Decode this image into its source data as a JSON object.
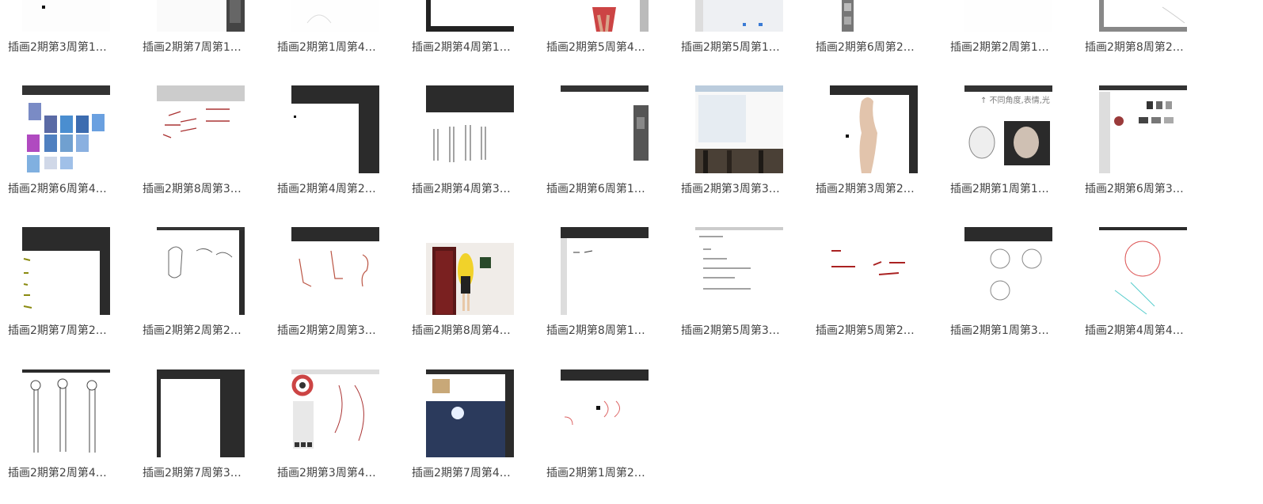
{
  "files": [
    {
      "name": "插画2期第3周第1…",
      "thumb": "blank-dot"
    },
    {
      "name": "插画2期第7周第1…",
      "thumb": "dark-right"
    },
    {
      "name": "插画2期第1周第4…",
      "thumb": "faint-sketch"
    },
    {
      "name": "插画2期第4周第1…",
      "thumb": "dark-frame"
    },
    {
      "name": "插画2期第5周第4…",
      "thumb": "red-figure"
    },
    {
      "name": "插画2期第5周第1…",
      "thumb": "white-panel"
    },
    {
      "name": "插画2期第6周第2…",
      "thumb": "gray-stack"
    },
    {
      "name": "插画2期第2周第1…",
      "thumb": "blank"
    },
    {
      "name": "插画2期第8周第2…",
      "thumb": "gray-frame"
    },
    {
      "name": "插画2期第6周第4…",
      "thumb": "color-grid"
    },
    {
      "name": "插画2期第8周第3…",
      "thumb": "red-notes"
    },
    {
      "name": "插画2期第4周第2…",
      "thumb": "dark-frame-big"
    },
    {
      "name": "插画2期第4周第3…",
      "thumb": "figures-lineup"
    },
    {
      "name": "插画2期第6周第1…",
      "thumb": "panel-right"
    },
    {
      "name": "插画2期第3周第3…",
      "thumb": "file-list-photo"
    },
    {
      "name": "插画2期第3周第2…",
      "thumb": "beige-silhouette"
    },
    {
      "name": "插画2期第1周第1…",
      "thumb": "skull-portrait"
    },
    {
      "name": "插画2期第6周第3…",
      "thumb": "shade-studies"
    },
    {
      "name": "插画2期第7周第2…",
      "thumb": "dark-green-text"
    },
    {
      "name": "插画2期第2周第2…",
      "thumb": "torso-sketch"
    },
    {
      "name": "插画2期第2周第3…",
      "thumb": "red-limbs"
    },
    {
      "name": "插画2期第8周第4…",
      "thumb": "girl-door"
    },
    {
      "name": "插画2期第8周第1…",
      "thumb": "dark-top-note"
    },
    {
      "name": "插画2期第5周第3…",
      "thumb": "list-notes"
    },
    {
      "name": "插画2期第5周第2…",
      "thumb": "red-notes-big"
    },
    {
      "name": "插画2期第1周第3…",
      "thumb": "heads-sketch"
    },
    {
      "name": "插画2期第4周第4…",
      "thumb": "anime-sketch"
    },
    {
      "name": "插画2期第2周第4…",
      "thumb": "body-figures"
    },
    {
      "name": "插画2期第7周第3…",
      "thumb": "white-canvas"
    },
    {
      "name": "插画2期第3周第4…",
      "thumb": "color-wheel"
    },
    {
      "name": "插画2期第7周第4…",
      "thumb": "night-sky"
    },
    {
      "name": "插画2期第1周第2…",
      "thumb": "red-scribble"
    }
  ]
}
